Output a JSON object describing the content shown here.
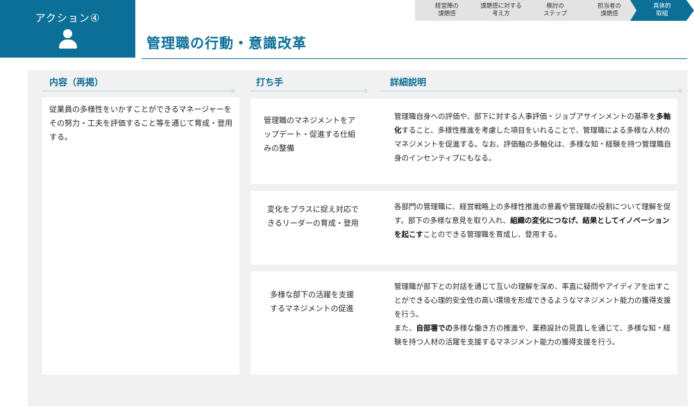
{
  "badge": {
    "label": "アクション④",
    "icon": "person-icon"
  },
  "title": "管理職の行動・意識改革",
  "steps": [
    {
      "label": "経営陣の\n課題感",
      "active": false
    },
    {
      "label": "課題感に対する\n考え方",
      "active": false
    },
    {
      "label": "検討の\nステップ",
      "active": false
    },
    {
      "label": "担当者の\n課題感",
      "active": false
    },
    {
      "label": "具体的\n取組",
      "active": true
    }
  ],
  "columns": {
    "content": "内容（再掲）",
    "measures": "打ち手",
    "details": "詳細説明"
  },
  "content_text": "従業員の多様性をいかすことができるマネージャーをその努力・工夫を評価すること等を通じて育成・登用する。",
  "rows": [
    {
      "measure": "管理職のマネジメントをアップデート・促進する仕組みの整備",
      "detail": [
        {
          "text": "管理職自身への評価や、部下に対する人事評価・ジョブアサインメントの基準を",
          "bold": false
        },
        {
          "text": "多軸化",
          "bold": true
        },
        {
          "text": "すること、多様性推進を考慮した項目をいれることで、管理職による多様な人材のマネジメントを促進する。なお、評価軸の多軸化は、多様な知・経験を持つ管理職自身のインセンティブにもなる。",
          "bold": false
        }
      ]
    },
    {
      "measure": "変化をプラスに捉え対応できるリーダーの育成・登用",
      "detail": [
        {
          "text": "各部門の管理職に、経営戦略上の多様性推進の意義や管理職の役割について理解を促す。部下の多様な意見を取り入れ、",
          "bold": false
        },
        {
          "text": "組織の変化につなげ、結果としてイノベーションを起こす",
          "bold": true
        },
        {
          "text": "ことのできる管理職を育成し、登用する。",
          "bold": false
        }
      ]
    },
    {
      "measure": "多様な部下の活躍を支援するマネジメントの促進",
      "detail": [
        {
          "text": "管理職が部下との対話を通じて互いの理解を深め、率直に疑問やアイディアを出すことができる心理的安全性の高い環境を形成できるようなマネジメント能力の獲得支援を行う。\nまた、",
          "bold": false
        },
        {
          "text": "自部署での",
          "bold": true
        },
        {
          "text": "多様な働き方の推進や、業務設計の見直しを通じて、多様な知・経験を持つ人材の活躍を支援するマネジメント能力の獲得支援を行う。",
          "bold": false
        }
      ]
    }
  ]
}
